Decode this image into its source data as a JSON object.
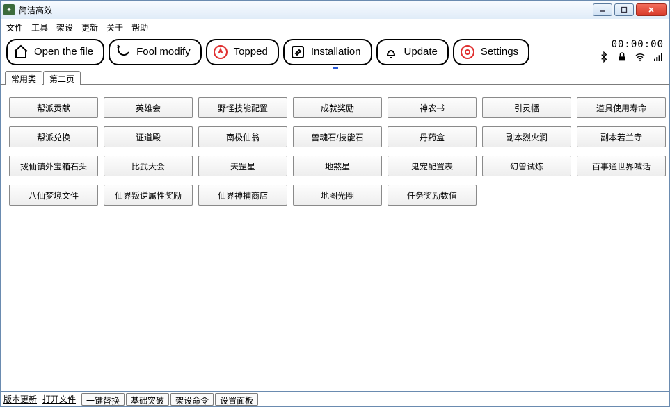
{
  "window": {
    "title": "简洁高效"
  },
  "menu": {
    "items": [
      "文件",
      "工具",
      "架设",
      "更新",
      "关于",
      "帮助"
    ]
  },
  "toolbar": {
    "buttons": [
      {
        "label": "Open the file",
        "icon": "home"
      },
      {
        "label": "Fool modify",
        "icon": "sync"
      },
      {
        "label": "Topped",
        "icon": "nav",
        "alt": true
      },
      {
        "label": "Installation",
        "icon": "edit"
      },
      {
        "label": "Update",
        "icon": "bell"
      },
      {
        "label": "Settings",
        "icon": "gear",
        "alt": true
      }
    ],
    "clock": "00:00:00"
  },
  "tabs": {
    "items": [
      "常用类",
      "第二页"
    ],
    "active_index": 1
  },
  "grid": {
    "buttons": [
      "帮派贡献",
      "英雄会",
      "野怪技能配置",
      "成就奖励",
      "神农书",
      "引灵幡",
      "道具使用寿命",
      "帮派兑换",
      "证道殿",
      "南极仙翁",
      "兽魂石/技能石",
      "丹药盒",
      "副本烈火涧",
      "副本若兰寺",
      "拨仙镇外宝箱石头",
      "比武大会",
      "天罡星",
      "地煞星",
      "鬼宠配置表",
      "幻兽试炼",
      "百事通世界喊话",
      "八仙梦境文件",
      "仙界叛逆属性奖励",
      "仙界神捕商店",
      "地图光圈",
      "任务奖励数值"
    ]
  },
  "bottom": {
    "links": [
      "版本更新",
      "打开文件"
    ],
    "tabs": [
      "一键替换",
      "基础突破",
      "架设命令",
      "设置面板"
    ]
  }
}
